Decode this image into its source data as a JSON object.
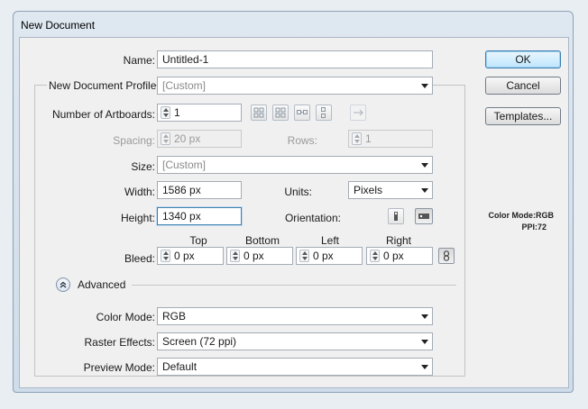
{
  "window": {
    "title": "New Document"
  },
  "form": {
    "name": {
      "label": "Name:",
      "value": "Untitled-1"
    },
    "profile": {
      "label": "New Document Profile:",
      "value": "[Custom]"
    },
    "artboards": {
      "label": "Number of Artboards:",
      "value": "1"
    },
    "spacing": {
      "label": "Spacing:",
      "value": "20 px"
    },
    "rows": {
      "label": "Rows:",
      "value": "1"
    },
    "size": {
      "label": "Size:",
      "value": "[Custom]"
    },
    "width": {
      "label": "Width:",
      "value": "1586 px"
    },
    "units": {
      "label": "Units:",
      "value": "Pixels"
    },
    "height": {
      "label": "Height:",
      "value": "1340 px"
    },
    "orientation": {
      "label": "Orientation:"
    },
    "bleed": {
      "label": "Bleed:",
      "top": {
        "label": "Top",
        "value": "0 px"
      },
      "bottom": {
        "label": "Bottom",
        "value": "0 px"
      },
      "left": {
        "label": "Left",
        "value": "0 px"
      },
      "right": {
        "label": "Right",
        "value": "0 px"
      }
    },
    "advanced": {
      "label": "Advanced"
    },
    "color_mode": {
      "label": "Color Mode:",
      "value": "RGB"
    },
    "raster_effects": {
      "label": "Raster Effects:",
      "value": "Screen (72 ppi)"
    },
    "preview_mode": {
      "label": "Preview Mode:",
      "value": "Default"
    }
  },
  "buttons": {
    "ok": "OK",
    "cancel": "Cancel",
    "templates": "Templates..."
  },
  "info": {
    "color_mode": "Color Mode:RGB",
    "ppi": "PPI:72"
  },
  "icons": {
    "artboard_layout": [
      "grid-by-row-icon",
      "grid-by-column-icon",
      "arrange-by-row-icon",
      "arrange-by-column-icon",
      "right-to-left-layout-icon"
    ],
    "orientation": [
      "portrait-icon",
      "landscape-icon"
    ],
    "bleed_link": "link-icon",
    "advanced": "collapse-chevron-icon"
  }
}
